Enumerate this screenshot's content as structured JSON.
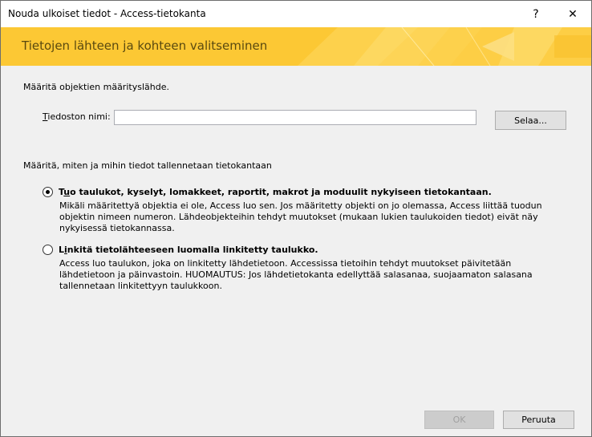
{
  "window": {
    "title": "Nouda ulkoiset tiedot - Access-tietokanta",
    "help_glyph": "?",
    "close_glyph": "✕"
  },
  "banner": {
    "heading": "Tietojen lähteen ja kohteen valitseminen",
    "accent_color": "#fcc834"
  },
  "source": {
    "instruction": "Määritä objektien määrityslähde.",
    "file_label_mnemonic": "T",
    "file_label_rest": "iedoston nimi:",
    "file_value": "",
    "browse_label": "Selaa..."
  },
  "destination": {
    "instruction": "Määritä, miten ja mihin tiedot tallennetaan tietokantaan",
    "options": [
      {
        "selected": true,
        "title_prefix": "T",
        "title_mnemonic": "u",
        "title_rest": "o taulukot, kyselyt, lomakkeet, raportit, makrot ja moduulit nykyiseen tietokantaan.",
        "description": "Mikäli määritettyä objektia ei ole, Access luo sen. Jos määritetty objekti on jo olemassa, Access liittää tuodun objektin nimeen numeron. Lähdeobjekteihin tehdyt muutokset (mukaan lukien taulukoiden tiedot) eivät näy nykyisessä tietokannassa."
      },
      {
        "selected": false,
        "title_prefix": "L",
        "title_mnemonic": "i",
        "title_rest": "nkitä tietolähteeseen luomalla linkitetty taulukko.",
        "description": "Access luo taulukon, joka on linkitetty lähdetietoon. Accessissa tietoihin tehdyt muutokset päivitetään lähdetietoon ja päinvastoin. HUOMAUTUS: Jos lähdetietokanta edellyttää salasanaa, suojaamaton salasana tallennetaan linkitettyyn taulukkoon."
      }
    ]
  },
  "footer": {
    "ok_label": "OK",
    "cancel_label": "Peruuta"
  }
}
